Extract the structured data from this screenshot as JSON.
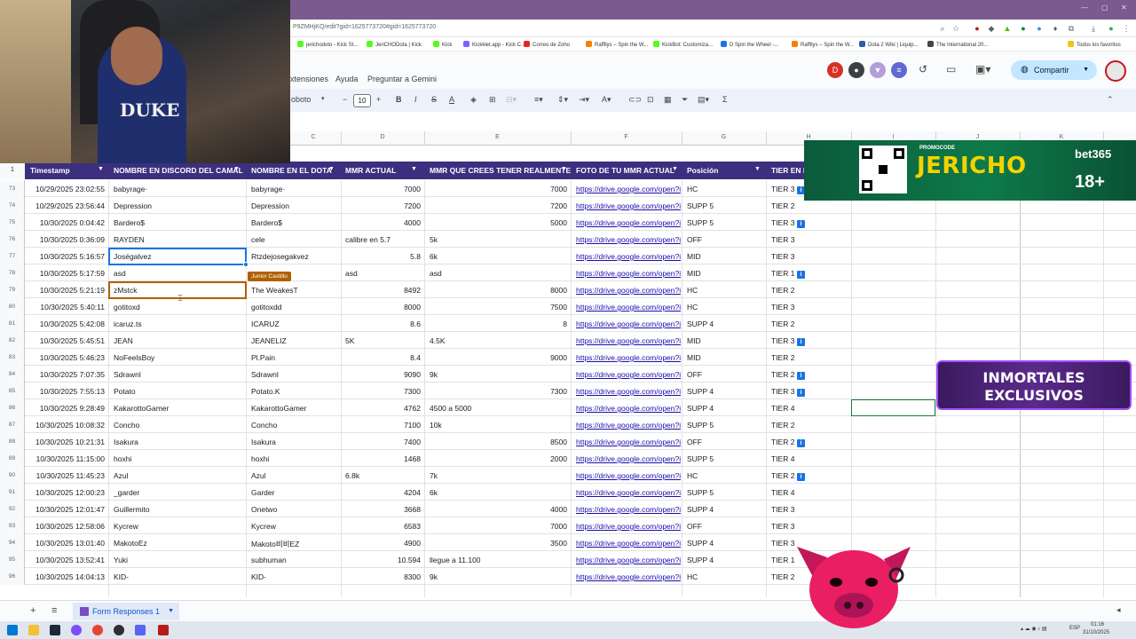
{
  "browser": {
    "url": "P9ZMHjKQ/edit?gid=1625773720#gid=1625773720",
    "bookmarks": [
      {
        "label": "jerichodoto - Kick St...",
        "color": "#53fc18"
      },
      {
        "label": "JeriCHODota | Kick",
        "color": "#53fc18"
      },
      {
        "label": "Kick",
        "color": "#53fc18"
      },
      {
        "label": "Kickklet.app - Kick C...",
        "color": "#7b61ff"
      },
      {
        "label": "Correo de Zoho",
        "color": "#e42527"
      },
      {
        "label": "Raffllys – Spin the W...",
        "color": "#ff7a00"
      },
      {
        "label": "KickBot: Customiza...",
        "color": "#53fc18"
      },
      {
        "label": "D Spin the Wheel -...",
        "color": "#1a73e8"
      },
      {
        "label": "Raffllys – Spin the W...",
        "color": "#ff7a00"
      },
      {
        "label": "Dota 2 Wiki | Liquip...",
        "color": "#2b5ea7"
      },
      {
        "label": "The International 20...",
        "color": "#444444"
      },
      {
        "label": "Todos los favoritos",
        "color": "#f1c40f"
      }
    ]
  },
  "sheets": {
    "menu": [
      "xtensiones",
      "Ayuda",
      "Preguntar a Gemini"
    ],
    "font": "oboto",
    "font_size": "10",
    "share_label": "Compartir",
    "avatar_letter": "D",
    "sheet_tab": "Form Responses 1"
  },
  "columns": {
    "letters": [
      "C",
      "D",
      "E",
      "F",
      "G",
      "H",
      "I",
      "J",
      "K"
    ],
    "headers": [
      "Timestamp",
      "NOMBRE EN DISCORD DEL CAMAL",
      "NOMBRE EN EL DOTA",
      "MMR ACTUAL",
      "MMR QUE CREES TENER REALMENTE",
      "FOTO DE TU MMR ACTUAL",
      "Posición",
      "TIER EN E"
    ]
  },
  "rows": [
    {
      "n": "73",
      "ts": "10/29/2025 23:02:55",
      "discord": "babyrage·",
      "dota": "babyrage·",
      "mmr": "7000",
      "mmr_r": "",
      "real": "7000",
      "real_r": "r",
      "foto": "https://drive.google.com/open?i",
      "pos": "HC",
      "tier": "TIER 3",
      "info": true
    },
    {
      "n": "74",
      "ts": "10/29/2025 23:56:44",
      "discord": "Depression",
      "dota": "Depression",
      "mmr": "7200",
      "mmr_r": "",
      "real": "7200",
      "real_r": "r",
      "foto": "https://drive.google.com/open?i",
      "pos": "SUPP 5",
      "tier": "TIER 2",
      "info": false
    },
    {
      "n": "75",
      "ts": "10/30/2025 0:04:42",
      "discord": "Bardero$",
      "dota": "Bardero$",
      "mmr": "4000",
      "mmr_r": "",
      "real": "5000",
      "real_r": "r",
      "foto": "https://drive.google.com/open?i",
      "pos": "SUPP 5",
      "tier": "TIER 3",
      "info": true
    },
    {
      "n": "76",
      "ts": "10/30/2025 0:36:09",
      "discord": "RAYDEN",
      "dota": "cele",
      "mmr": "calibre en 5.7",
      "mmr_r": "l",
      "real": "5k",
      "real_r": "l",
      "foto": "https://drive.google.com/open?i",
      "pos": "OFF",
      "tier": "TIER 3",
      "info": false
    },
    {
      "n": "77",
      "ts": "10/30/2025 5:16:57",
      "discord": "Joségalvez",
      "dota": "Rtzdejosegakvez",
      "mmr": "5.8",
      "mmr_r": "",
      "real": "6k",
      "real_r": "l",
      "foto": "https://drive.google.com/open?i",
      "pos": "MID",
      "tier": "TIER 3",
      "info": false
    },
    {
      "n": "78",
      "ts": "10/30/2025 5:17:59",
      "discord": "asd",
      "dota": "a",
      "mmr": "asd",
      "mmr_r": "l",
      "real": "asd",
      "real_r": "l",
      "foto": "https://drive.google.com/open?i",
      "pos": "MID",
      "tier": "TIER 1",
      "info": true
    },
    {
      "n": "79",
      "ts": "10/30/2025 5:21:19",
      "discord": "zMstck",
      "dota": "The WeakesT",
      "mmr": "8492",
      "mmr_r": "",
      "real": "8000",
      "real_r": "r",
      "foto": "https://drive.google.com/open?i",
      "pos": "HC",
      "tier": "TIER 2",
      "info": false
    },
    {
      "n": "80",
      "ts": "10/30/2025 5:40:11",
      "discord": "gotitoxd",
      "dota": "gotitoxdd",
      "mmr": "8000",
      "mmr_r": "",
      "real": "7500",
      "real_r": "r",
      "foto": "https://drive.google.com/open?i",
      "pos": "HC",
      "tier": "TIER 3",
      "info": false
    },
    {
      "n": "81",
      "ts": "10/30/2025 5:42:08",
      "discord": "icaruz.ts",
      "dota": "ICARUZ",
      "mmr": "8.6",
      "mmr_r": "",
      "real": "8",
      "real_r": "r",
      "foto": "https://drive.google.com/open?i",
      "pos": "SUPP 4",
      "tier": "TIER 2",
      "info": false
    },
    {
      "n": "82",
      "ts": "10/30/2025 5:45:51",
      "discord": "JEAN",
      "dota": "JEANELIZ",
      "mmr": "5K",
      "mmr_r": "l",
      "real": "4.5K",
      "real_r": "l",
      "foto": "https://drive.google.com/open?i",
      "pos": "MID",
      "tier": "TIER 3",
      "info": true
    },
    {
      "n": "83",
      "ts": "10/30/2025 5:46:23",
      "discord": "NoFeelsBoy",
      "dota": "Pl.Pain",
      "mmr": "8.4",
      "mmr_r": "",
      "real": "9000",
      "real_r": "r",
      "foto": "https://drive.google.com/open?i",
      "pos": "MID",
      "tier": "TIER 2",
      "info": false
    },
    {
      "n": "84",
      "ts": "10/30/2025 7:07:35",
      "discord": "Sdrawnl",
      "dota": "Sdrawnl",
      "mmr": "9090",
      "mmr_r": "",
      "real": "9k",
      "real_r": "l",
      "foto": "https://drive.google.com/open?i",
      "pos": "OFF",
      "tier": "TIER 2",
      "info": true
    },
    {
      "n": "85",
      "ts": "10/30/2025 7:55:13",
      "discord": "Potato",
      "dota": "Potato.K",
      "mmr": "7300",
      "mmr_r": "",
      "real": "7300",
      "real_r": "r",
      "foto": "https://drive.google.com/open?i",
      "pos": "SUPP 4",
      "tier": "TIER 3",
      "info": true
    },
    {
      "n": "86",
      "ts": "10/30/2025 9:28:49",
      "discord": "KakarottoGamer",
      "dota": "KakarottoGamer",
      "mmr": "4762",
      "mmr_r": "",
      "real": "4500 a 5000",
      "real_r": "l",
      "foto": "https://drive.google.com/open?i",
      "pos": "SUPP 4",
      "tier": "TIER 4",
      "info": false
    },
    {
      "n": "87",
      "ts": "10/30/2025 10:08:32",
      "discord": "Concho",
      "dota": "Concho",
      "mmr": "7100",
      "mmr_r": "",
      "real": "10k",
      "real_r": "l",
      "foto": "https://drive.google.com/open?i",
      "pos": "SUPP 5",
      "tier": "TIER 2",
      "info": false
    },
    {
      "n": "88",
      "ts": "10/30/2025 10:21:31",
      "discord": "Isakura",
      "dota": "Isakura",
      "mmr": "7400",
      "mmr_r": "",
      "real": "8500",
      "real_r": "r",
      "foto": "https://drive.google.com/open?i",
      "pos": "OFF",
      "tier": "TIER 2",
      "info": true
    },
    {
      "n": "89",
      "ts": "10/30/2025 11:15:00",
      "discord": "hoxhi",
      "dota": "hoxhi",
      "mmr": "1468",
      "mmr_r": "",
      "real": "2000",
      "real_r": "r",
      "foto": "https://drive.google.com/open?i",
      "pos": "SUPP 5",
      "tier": "TIER 4",
      "info": false
    },
    {
      "n": "90",
      "ts": "10/30/2025 11:45:23",
      "discord": "Azul",
      "dota": "Azul",
      "mmr": "6.8k",
      "mmr_r": "l",
      "real": "7k",
      "real_r": "l",
      "foto": "https://drive.google.com/open?i",
      "pos": "HC",
      "tier": "TIER 2",
      "info": true
    },
    {
      "n": "91",
      "ts": "10/30/2025 12:00:23",
      "discord": "_garder",
      "dota": "Garder",
      "mmr": "4204",
      "mmr_r": "",
      "real": "6k",
      "real_r": "l",
      "foto": "https://drive.google.com/open?i",
      "pos": "SUPP 5",
      "tier": "TIER 4",
      "info": false
    },
    {
      "n": "92",
      "ts": "10/30/2025 12:01:47",
      "discord": "Guillermito",
      "dota": "Onetwo",
      "mmr": "3668",
      "mmr_r": "",
      "real": "4000",
      "real_r": "r",
      "foto": "https://drive.google.com/open?i",
      "pos": "SUPP 4",
      "tier": "TIER 3",
      "info": false
    },
    {
      "n": "93",
      "ts": "10/30/2025 12:58:06",
      "discord": "Kycrew",
      "dota": "Kycrew",
      "mmr": "6583",
      "mmr_r": "",
      "real": "7000",
      "real_r": "r",
      "foto": "https://drive.google.com/open?i",
      "pos": "OFF",
      "tier": "TIER 3",
      "info": false
    },
    {
      "n": "94",
      "ts": "10/30/2025 13:01:40",
      "discord": "MakotoEz",
      "dota": "Makoto비비EZ",
      "mmr": "4900",
      "mmr_r": "",
      "real": "3500",
      "real_r": "r",
      "foto": "https://drive.google.com/open?i",
      "pos": "SUPP 4",
      "tier": "TIER 3",
      "info": false
    },
    {
      "n": "95",
      "ts": "10/30/2025 13:52:41",
      "discord": "Yuki",
      "dota": "subhuman",
      "mmr": "10.594",
      "mmr_r": "",
      "real": "llegue a 11.100",
      "real_r": "l",
      "foto": "https://drive.google.com/open?i",
      "pos": "SUPP 4",
      "tier": "TIER 1",
      "info": false
    },
    {
      "n": "96",
      "ts": "10/30/2025 14:04:13",
      "discord": "KID-",
      "dota": "KID-",
      "mmr": "8300",
      "mmr_r": "",
      "real": "9k",
      "real_r": "l",
      "foto": "https://drive.google.com/open?i",
      "pos": "HC",
      "tier": "TIER 2",
      "info": false
    }
  ],
  "selection": {
    "collaborator": "Junior Castillo"
  },
  "overlays": {
    "promo_code_label": "PROMOCODE",
    "promo_code": "JERICHO",
    "promo_brand": "bet365",
    "promo_age": "18+",
    "badge_line1": "INMORTALES",
    "badge_line2": "EXCLUSIVOS",
    "shirt_text": "DUKE"
  },
  "taskbar": {
    "lang": "ESP",
    "time": "01:16",
    "date": "31/10/2025"
  },
  "colors": {
    "header_bg": "#3c2f7f",
    "link": "#1a0dab",
    "selection": "#1a73e8",
    "collab": "#b06000"
  }
}
